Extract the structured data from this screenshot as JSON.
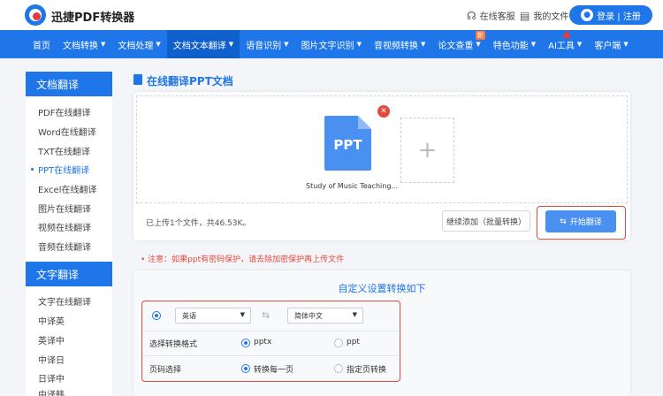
{
  "header": {
    "brand": "迅捷PDF转换器",
    "service_label": "在线客服",
    "files_label": "我的文件",
    "login_label": "登录 | 注册"
  },
  "nav": {
    "items": [
      {
        "label": "首页",
        "caret": false
      },
      {
        "label": "文档转换",
        "caret": true
      },
      {
        "label": "文档处理",
        "caret": true
      },
      {
        "label": "文档文本翻译",
        "caret": true,
        "active": true
      },
      {
        "label": "语音识别",
        "caret": true
      },
      {
        "label": "图片文字识别",
        "caret": true
      },
      {
        "label": "音视频转换",
        "caret": true
      },
      {
        "label": "论文查重",
        "caret": true,
        "badge": "新"
      },
      {
        "label": "特色功能",
        "caret": true
      },
      {
        "label": "AI工具",
        "caret": true,
        "hot": true
      },
      {
        "label": "客户端",
        "caret": true
      }
    ]
  },
  "sidebar": {
    "doc_heading": "文档翻译",
    "doc_items": [
      "PDF在线翻译",
      "Word在线翻译",
      "TXT在线翻译",
      "PPT在线翻译",
      "Excel在线翻译",
      "图片在线翻译",
      "视频在线翻译",
      "音频在线翻译"
    ],
    "doc_active_index": 3,
    "text_heading": "文字翻译",
    "text_items": [
      "文字在线翻译",
      "中译英",
      "英译中",
      "中译日",
      "日译中",
      "中译韩"
    ]
  },
  "main": {
    "title": "在线翻译PPT文档",
    "file": {
      "ext": "PPT",
      "name": "Study of Music Teaching..."
    },
    "add_symbol": "+",
    "uploaded_info": "已上传1个文件，共46.53K。",
    "continue_label": "继续添加（批量转换）",
    "start_label": "开始翻译",
    "notice": "注意：如果ppt有密码保护，请去除加密保护再上传文件"
  },
  "settings": {
    "title": "自定义设置转换如下",
    "source_lang": "英语",
    "target_lang": "简体中文",
    "format_label": "选择转换格式",
    "format_options": [
      "pptx",
      "ppt"
    ],
    "format_selected": "pptx",
    "page_label": "页码选择",
    "page_options": [
      "转换每一页",
      "指定页转换"
    ],
    "page_selected": "转换每一页"
  },
  "colors": {
    "primary": "#1f76e9",
    "accent_red": "#e5483d",
    "file_blue": "#4a90f0"
  }
}
